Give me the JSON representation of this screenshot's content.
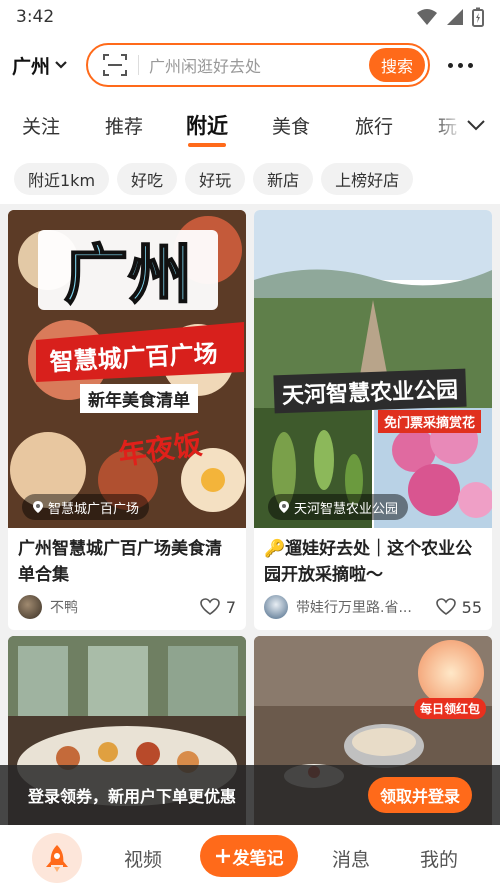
{
  "status_bar": {
    "time": "3:42"
  },
  "header": {
    "city": "广州",
    "search_placeholder": "广州闲逛好去处",
    "search_button": "搜索"
  },
  "tabs": [
    {
      "label": "关注"
    },
    {
      "label": "推荐"
    },
    {
      "label": "附近",
      "active": true
    },
    {
      "label": "美食"
    },
    {
      "label": "旅行"
    },
    {
      "label": "玩"
    }
  ],
  "chips": [
    {
      "label": "附近1km"
    },
    {
      "label": "好吃"
    },
    {
      "label": "好玩"
    },
    {
      "label": "新店"
    },
    {
      "label": "上榜好店"
    }
  ],
  "cards": [
    {
      "image": {
        "headline": "广州",
        "banner": "智慧城广百广场",
        "subtitle": "新年美食清单",
        "stamp": "年夜饭"
      },
      "location": "智慧城广百广场",
      "title": "广州智慧城广百广场美食清单合集",
      "author": "不鸭",
      "likes": "7"
    },
    {
      "image": {
        "banner": "天河智慧农业公园",
        "subtitle": "免门票采摘赏花"
      },
      "location": "天河智慧农业公园",
      "title": "🔑遛娃好去处｜这个农业公园开放采摘啦～",
      "author": "带娃行万里路.省...",
      "likes": "55"
    },
    {
      "image": {}
    },
    {
      "image": {
        "badge": "每日领红包"
      }
    }
  ],
  "promo": {
    "text": "登录领券，新用户下单更优惠",
    "button": "领取并登录"
  },
  "bottom_nav": {
    "video": "视频",
    "publish": "发笔记",
    "messages": "消息",
    "me": "我的"
  },
  "colors": {
    "accent": "#ff6a1a"
  }
}
